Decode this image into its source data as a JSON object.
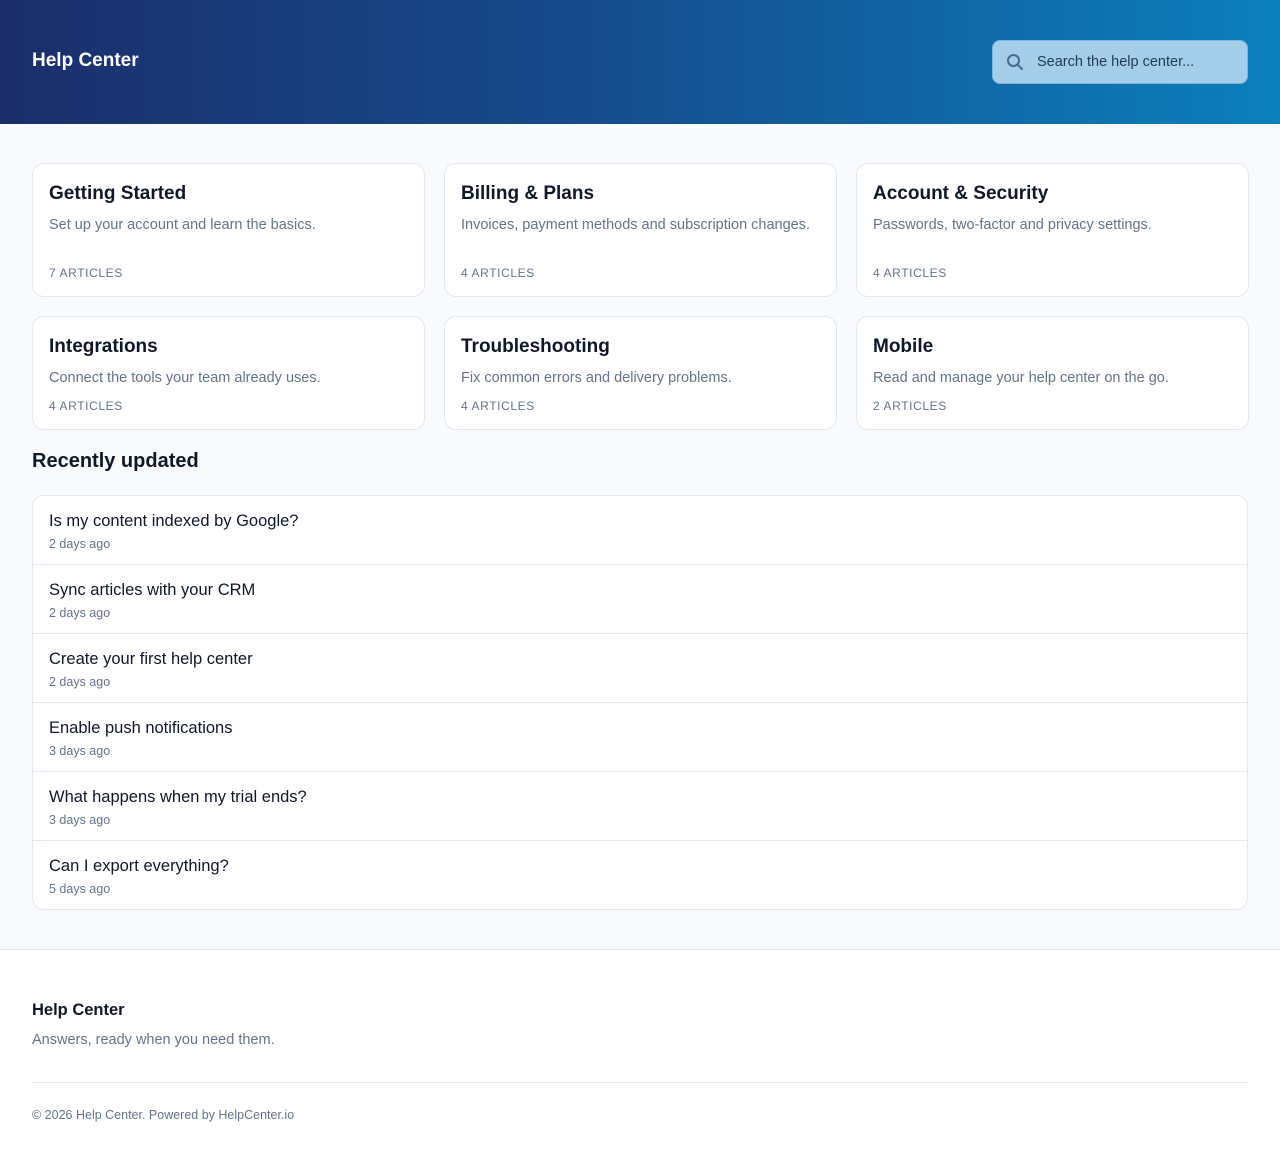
{
  "header": {
    "title": "Help Center",
    "search_placeholder": "Search the help center...",
    "search_icon": "search-icon"
  },
  "categories": [
    {
      "title": "Getting Started",
      "description": "Set up your account and learn the basics.",
      "count": "7 ARTICLES"
    },
    {
      "title": "Billing & Plans",
      "description": "Invoices, payment methods and subscription changes.",
      "count": "4 ARTICLES"
    },
    {
      "title": "Account & Security",
      "description": "Passwords, two-factor and privacy settings.",
      "count": "4 ARTICLES"
    },
    {
      "title": "Integrations",
      "description": "Connect the tools your team already uses.",
      "count": "4 ARTICLES"
    },
    {
      "title": "Troubleshooting",
      "description": "Fix common errors and delivery problems.",
      "count": "4 ARTICLES"
    },
    {
      "title": "Mobile",
      "description": "Read and manage your help center on the go.",
      "count": "2 ARTICLES"
    }
  ],
  "recent": {
    "title": "Recently updated",
    "items": [
      {
        "title": "Is my content indexed by Google?",
        "time": "2 days ago"
      },
      {
        "title": "Sync articles with your CRM",
        "time": "2 days ago"
      },
      {
        "title": "Create your first help center",
        "time": "2 days ago"
      },
      {
        "title": "Enable push notifications",
        "time": "3 days ago"
      },
      {
        "title": "What happens when my trial ends?",
        "time": "3 days ago"
      },
      {
        "title": "Can I export everything?",
        "time": "5 days ago"
      }
    ]
  },
  "footer": {
    "title": "Help Center",
    "tagline": "Answers, ready when you need them.",
    "copyright": "© 2026 Help Center. Powered by HelpCenter.io"
  },
  "colors": {
    "header_gradient_start": "#1b2e6b",
    "header_gradient_end": "#0b80bd",
    "search_bg": "#a4cdea",
    "text_primary": "#0f172a",
    "text_muted": "#64748b",
    "border": "#e2e8f0"
  }
}
